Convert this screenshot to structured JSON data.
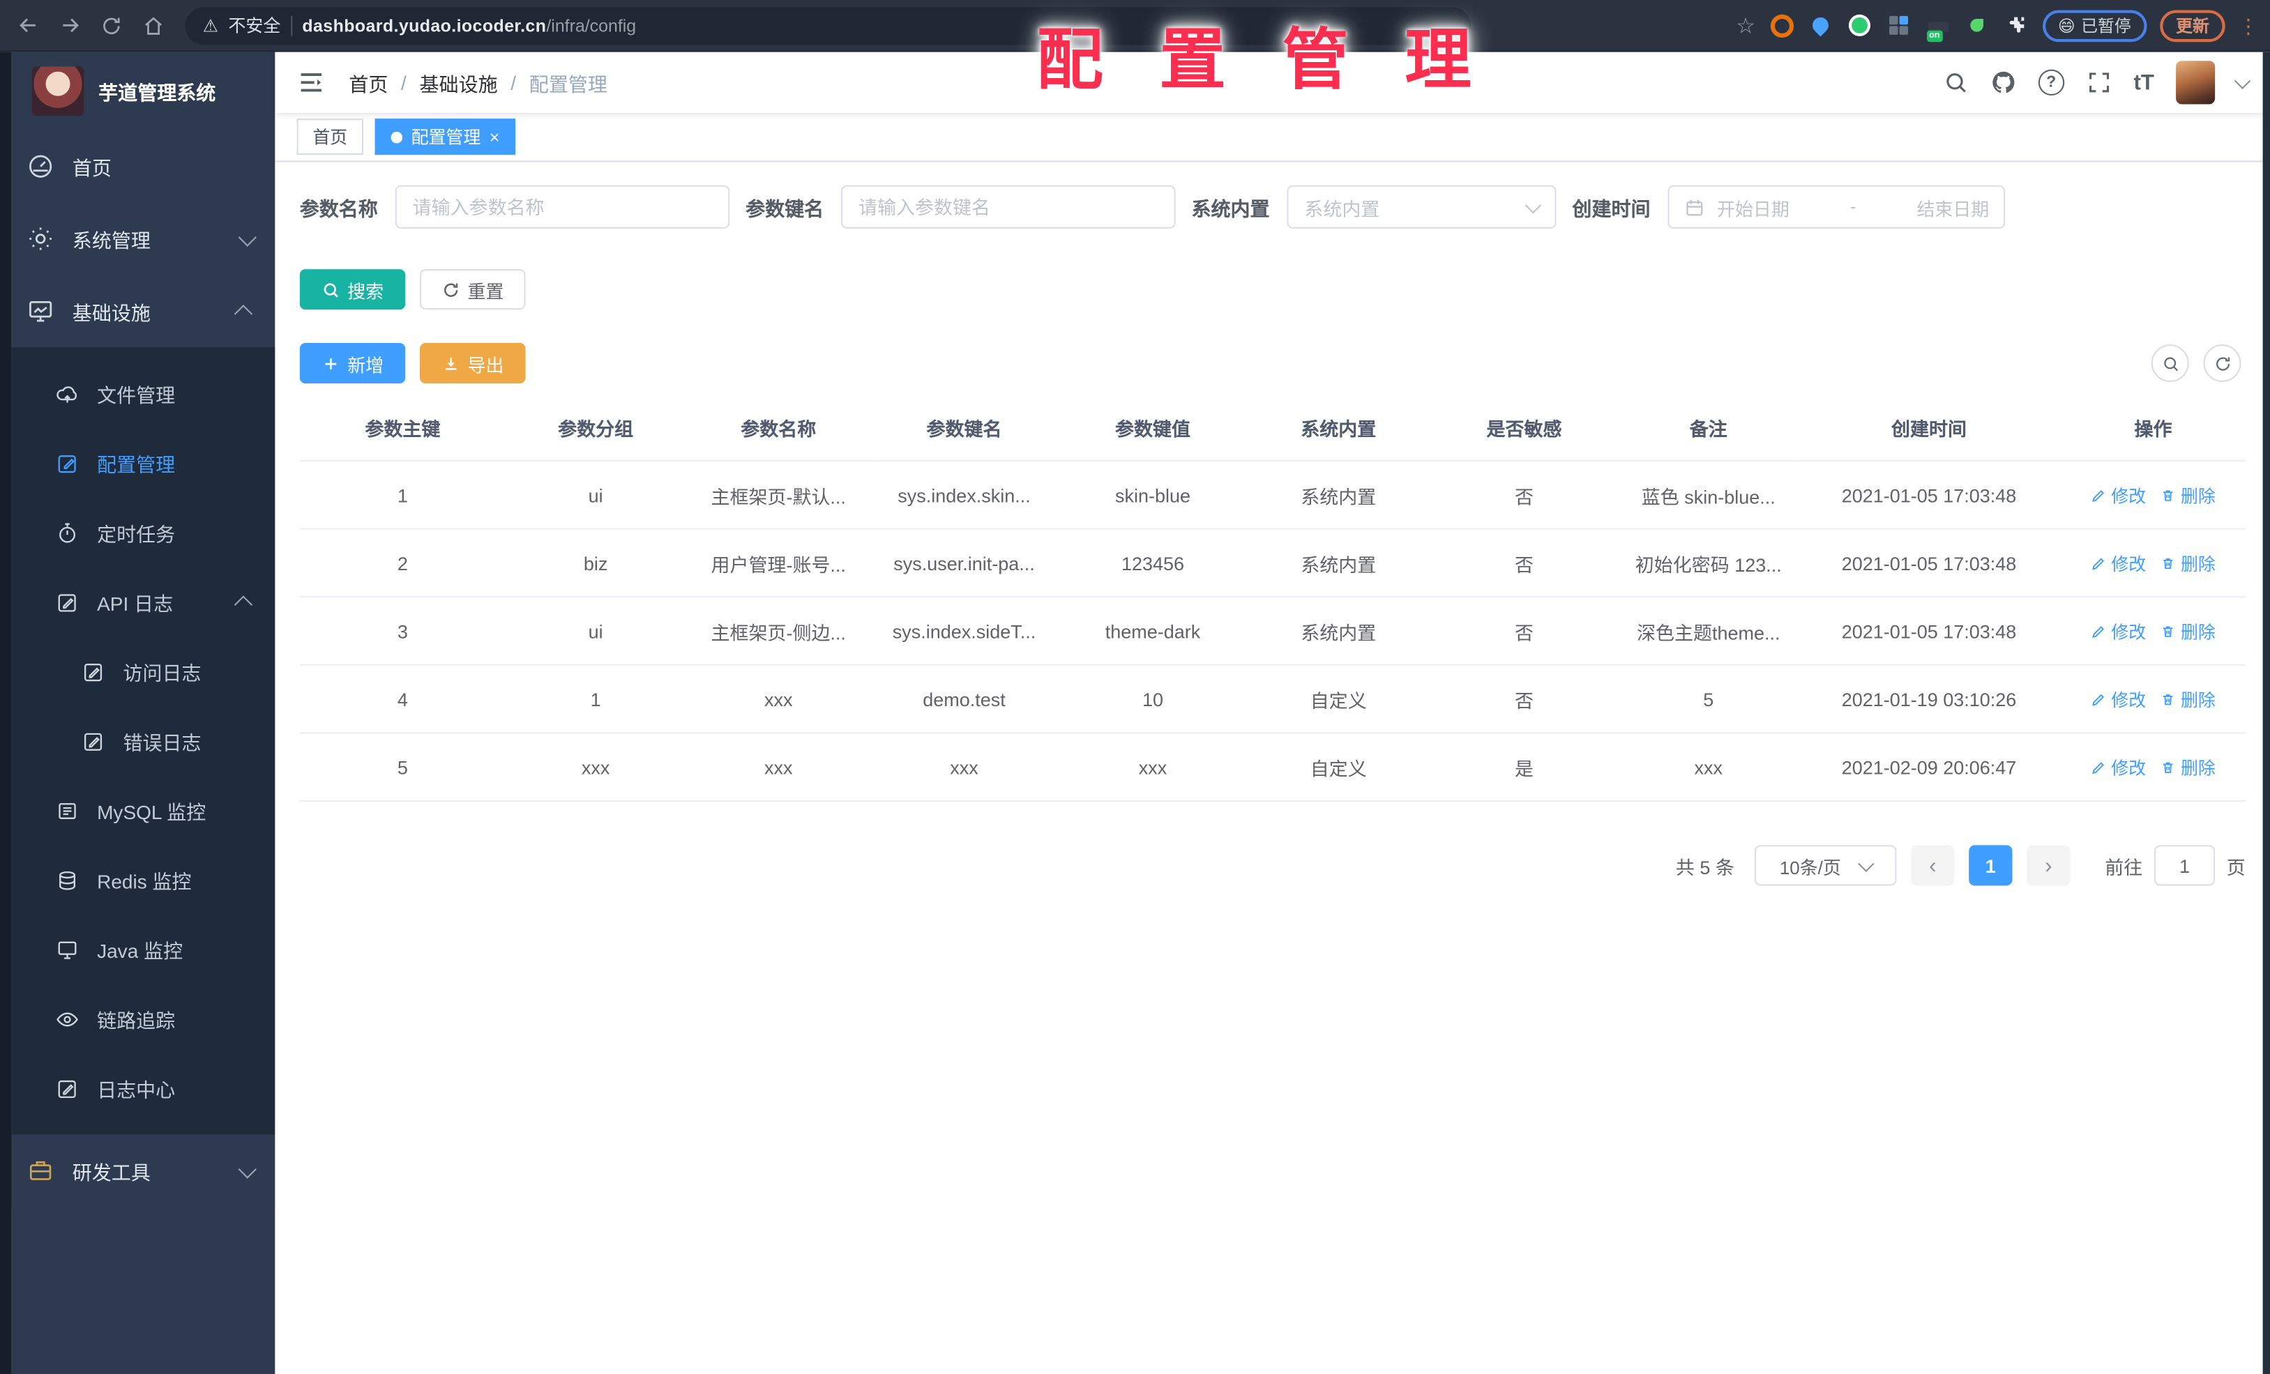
{
  "browser": {
    "security_label": "不安全",
    "warning_icon": "⚠",
    "url_host": "dashboard.yudao.iocoder.cn",
    "url_path": "/infra/config",
    "bookmark_icon": "☆",
    "ext_badge": "on",
    "paused_emoji": "😄",
    "paused_label": "已暂停",
    "update_label": "更新",
    "menu_icon": "⋮"
  },
  "sidebar": {
    "app_title": "芋道管理系统",
    "items": [
      {
        "label": "首页"
      },
      {
        "label": "系统管理"
      },
      {
        "label": "基础设施"
      }
    ],
    "sub_items": [
      {
        "label": "文件管理"
      },
      {
        "label": "配置管理",
        "active": true
      },
      {
        "label": "定时任务"
      },
      {
        "label": "API 日志"
      },
      {
        "label": "访问日志"
      },
      {
        "label": "错误日志"
      },
      {
        "label": "MySQL 监控"
      },
      {
        "label": "Redis 监控"
      },
      {
        "label": "Java 监控"
      },
      {
        "label": "链路追踪"
      },
      {
        "label": "日志中心"
      }
    ],
    "bottom_item": {
      "label": "研发工具"
    }
  },
  "navbar": {
    "breadcrumb": [
      "首页",
      "基础设施",
      "配置管理"
    ],
    "separator": "/",
    "help_icon": "?",
    "font_size_icon": "tT"
  },
  "tabs": [
    {
      "label": "首页",
      "active": false
    },
    {
      "label": "配置管理",
      "active": true,
      "close_icon": "×"
    }
  ],
  "overlay_title": "配 置 管 理",
  "filters": {
    "name_label": "参数名称",
    "name_placeholder": "请输入参数名称",
    "key_label": "参数键名",
    "key_placeholder": "请输入参数键名",
    "type_label": "系统内置",
    "type_placeholder": "系统内置",
    "date_label": "创建时间",
    "date_start": "开始日期",
    "date_separator": "-",
    "date_end": "结束日期"
  },
  "toolbar": {
    "search": "搜索",
    "reset": "重置",
    "add": "新增",
    "export": "导出"
  },
  "table": {
    "columns": [
      "参数主键",
      "参数分组",
      "参数名称",
      "参数键名",
      "参数键值",
      "系统内置",
      "是否敏感",
      "备注",
      "创建时间",
      "操作"
    ],
    "action_labels": {
      "edit": "修改",
      "delete": "删除"
    },
    "rows": [
      {
        "cells": [
          "1",
          "ui",
          "主框架页-默认...",
          "sys.index.skin...",
          "skin-blue",
          "系统内置",
          "否",
          "蓝色 skin-blue...",
          "2021-01-05 17:03:48"
        ]
      },
      {
        "cells": [
          "2",
          "biz",
          "用户管理-账号...",
          "sys.user.init-pa...",
          "123456",
          "系统内置",
          "否",
          "初始化密码 123...",
          "2021-01-05 17:03:48"
        ]
      },
      {
        "cells": [
          "3",
          "ui",
          "主框架页-侧边...",
          "sys.index.sideT...",
          "theme-dark",
          "系统内置",
          "否",
          "深色主题theme...",
          "2021-01-05 17:03:48"
        ]
      },
      {
        "cells": [
          "4",
          "1",
          "xxx",
          "demo.test",
          "10",
          "自定义",
          "否",
          "5",
          "2021-01-19 03:10:26"
        ]
      },
      {
        "cells": [
          "5",
          "xxx",
          "xxx",
          "xxx",
          "xxx",
          "自定义",
          "是",
          "xxx",
          "2021-02-09 20:06:47"
        ]
      }
    ]
  },
  "pagination": {
    "total": "共 5 条",
    "page_size": "10条/页",
    "prev": "‹",
    "current_page": "1",
    "next": "›",
    "goto_label": "前往",
    "goto_value": "1",
    "unit": "页"
  },
  "colors": {
    "primary": "#409EFF",
    "search_button": "#17B3A3",
    "export_button": "#EFA844",
    "overlay_red": "#FB2E50",
    "sidebar_bg": "#2D3A4F",
    "submenu_bg": "#1F2B3B",
    "chrome_bg": "#2A333F"
  }
}
